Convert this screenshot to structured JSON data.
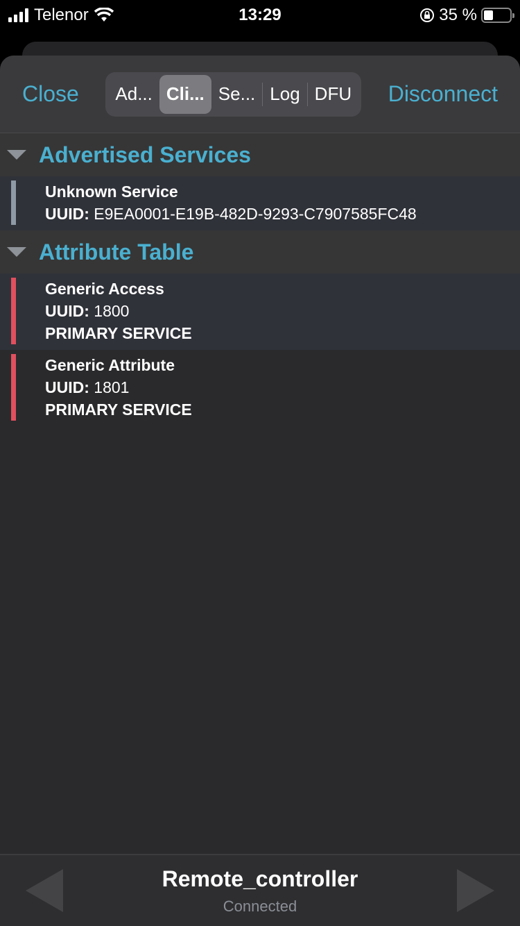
{
  "status_bar": {
    "carrier": "Telenor",
    "time": "13:29",
    "battery_percent_label": "35 %",
    "battery_level": 0.35,
    "icons": [
      "signal-icon",
      "wifi-icon",
      "rotation-lock-icon",
      "battery-icon"
    ]
  },
  "toolbar": {
    "close_label": "Close",
    "disconnect_label": "Disconnect",
    "tabs": [
      {
        "label": "Ad...",
        "active": false
      },
      {
        "label": "Cli...",
        "active": true
      },
      {
        "label": "Se...",
        "active": false
      },
      {
        "label": "Log",
        "active": false
      },
      {
        "label": "DFU",
        "active": false
      }
    ]
  },
  "sections": [
    {
      "title": "Advertised Services",
      "items": [
        {
          "name": "Unknown Service",
          "uuid_label": "UUID:",
          "uuid": "E9EA0001-E19B-482D-9293-C7907585FC48",
          "bar_color": "#8e9aa6"
        }
      ]
    },
    {
      "title": "Attribute Table",
      "items": [
        {
          "name": "Generic Access",
          "uuid_label": "UUID:",
          "uuid": "1800",
          "type": "PRIMARY SERVICE",
          "bar_color": "#e0505e"
        },
        {
          "name": "Generic Attribute",
          "uuid_label": "UUID:",
          "uuid": "1801",
          "type": "PRIMARY SERVICE",
          "bar_color": "#e0505e"
        }
      ]
    }
  ],
  "footer": {
    "device_name": "Remote_controller",
    "status": "Connected"
  },
  "colors": {
    "accent": "#4ab0d0",
    "service_bar": "#e0505e",
    "advertised_bar": "#8e9aa6"
  }
}
